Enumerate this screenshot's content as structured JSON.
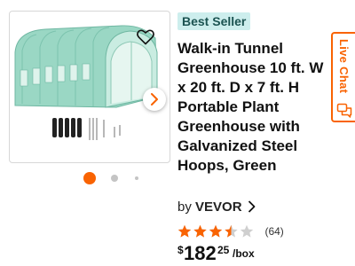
{
  "product": {
    "badge": "Best Seller",
    "title": "Walk-in Tunnel Greenhouse 10 ft. W x 20 ft. D x 7 ft. H Portable Plant Greenhouse with Galvanized Steel Hoops, Green",
    "brand_prefix": "by",
    "brand_name": "VEVOR",
    "rating": 3.5,
    "rating_max": 5,
    "review_count": "(64)",
    "price": {
      "currency": "$",
      "dollars": "182",
      "cents": "25",
      "unit": "/box"
    }
  },
  "gallery": {
    "image_count": 3,
    "active_index": 0
  },
  "live_chat": {
    "label": "Live Chat"
  },
  "icons": {
    "favorite": "heart-outline-icon",
    "next": "chevron-right-icon",
    "brand_link": "chevron-right-icon",
    "chat": "chat-bubbles-icon"
  },
  "colors": {
    "accent": "#f96302",
    "badge_bg": "#cdeeed",
    "badge_text": "#1b5351",
    "star": "#f96302",
    "greenhouse": "#8fd2bd"
  }
}
